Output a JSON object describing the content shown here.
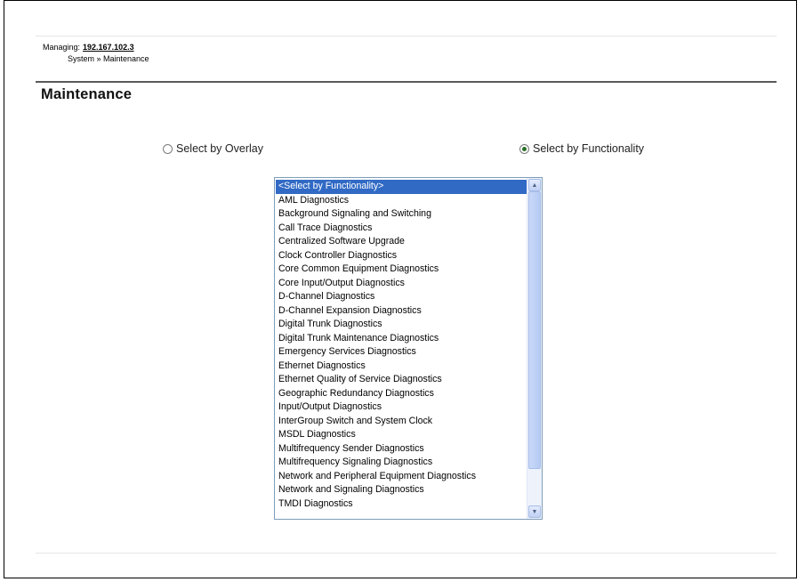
{
  "header": {
    "managing_label": "Managing:",
    "managing_ip": "192.167.102.3",
    "breadcrumb": "System » Maintenance"
  },
  "page": {
    "title": "Maintenance"
  },
  "selection_mode": {
    "overlay_label": "Select by Overlay",
    "functionality_label": "Select by Functionality",
    "selected": "functionality"
  },
  "functionality_list": {
    "selected_index": 0,
    "items": [
      "<Select by Functionality>",
      "AML Diagnostics",
      "Background Signaling and Switching",
      "Call Trace Diagnostics",
      "Centralized Software Upgrade",
      "Clock Controller Diagnostics",
      "Core Common Equipment Diagnostics",
      "Core Input/Output Diagnostics",
      "D-Channel Diagnostics",
      "D-Channel Expansion Diagnostics",
      "Digital Trunk Diagnostics",
      "Digital Trunk Maintenance Diagnostics",
      "Emergency Services Diagnostics",
      "Ethernet Diagnostics",
      "Ethernet Quality of Service Diagnostics",
      "Geographic Redundancy  Diagnostics",
      "Input/Output Diagnostics",
      "InterGroup Switch and System Clock",
      "MSDL Diagnostics",
      "Multifrequency Sender Diagnostics",
      "Multifrequency Signaling Diagnostics",
      "Network and Peripheral Equipment Diagnostics",
      "Network and Signaling Diagnostics",
      "TMDI Diagnostics"
    ]
  },
  "icons": {
    "scroll_up": "chevron-up-icon",
    "scroll_down": "chevron-down-icon"
  },
  "colors": {
    "selection_highlight": "#316ac5",
    "title_rule": "#5a5a5a"
  }
}
